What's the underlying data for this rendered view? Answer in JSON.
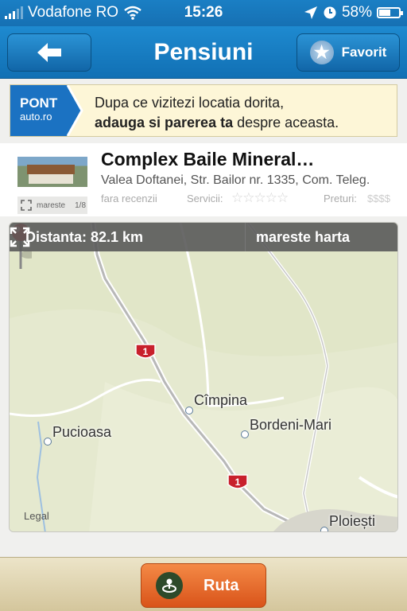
{
  "status": {
    "carrier": "Vodafone RO",
    "time": "15:26",
    "battery": "58%",
    "battery_level": 0.58
  },
  "nav": {
    "title": "Pensiuni",
    "favorite_label": "Favorit"
  },
  "banner": {
    "logo_line1": "PONT",
    "logo_line2": "auto.ro",
    "line1": "Dupa ce vizitezi locatia dorita,",
    "line2_bold": "adauga si parerea ta",
    "line2_rest": " despre aceasta."
  },
  "listing": {
    "title": "Complex Baile Mineral…",
    "address": "Valea Doftanei, Str. Bailor nr. 1335, Com. Teleg.",
    "reviews": "fara recenzii",
    "services_label": "Servicii:",
    "services_stars": "☆☆☆☆☆",
    "prices_label": "Preturi:",
    "prices_value": "$$$$",
    "photo_label": "mareste",
    "photo_count": "1/8"
  },
  "map": {
    "distance": "Distanta: 82.1 km",
    "expand_label": "mareste harta",
    "legal": "Legal",
    "cities": [
      "Cîmpina",
      "Bordeni-Mari",
      "Pucioasa",
      "Ploiești"
    ],
    "route_number": "1"
  },
  "bottom": {
    "route_button": "Ruta"
  },
  "colors": {
    "nav_blue": "#1a7fc4",
    "button_orange": "#e96a2c",
    "pin_red": "#d81e1e",
    "route_red": "#c8202c"
  }
}
